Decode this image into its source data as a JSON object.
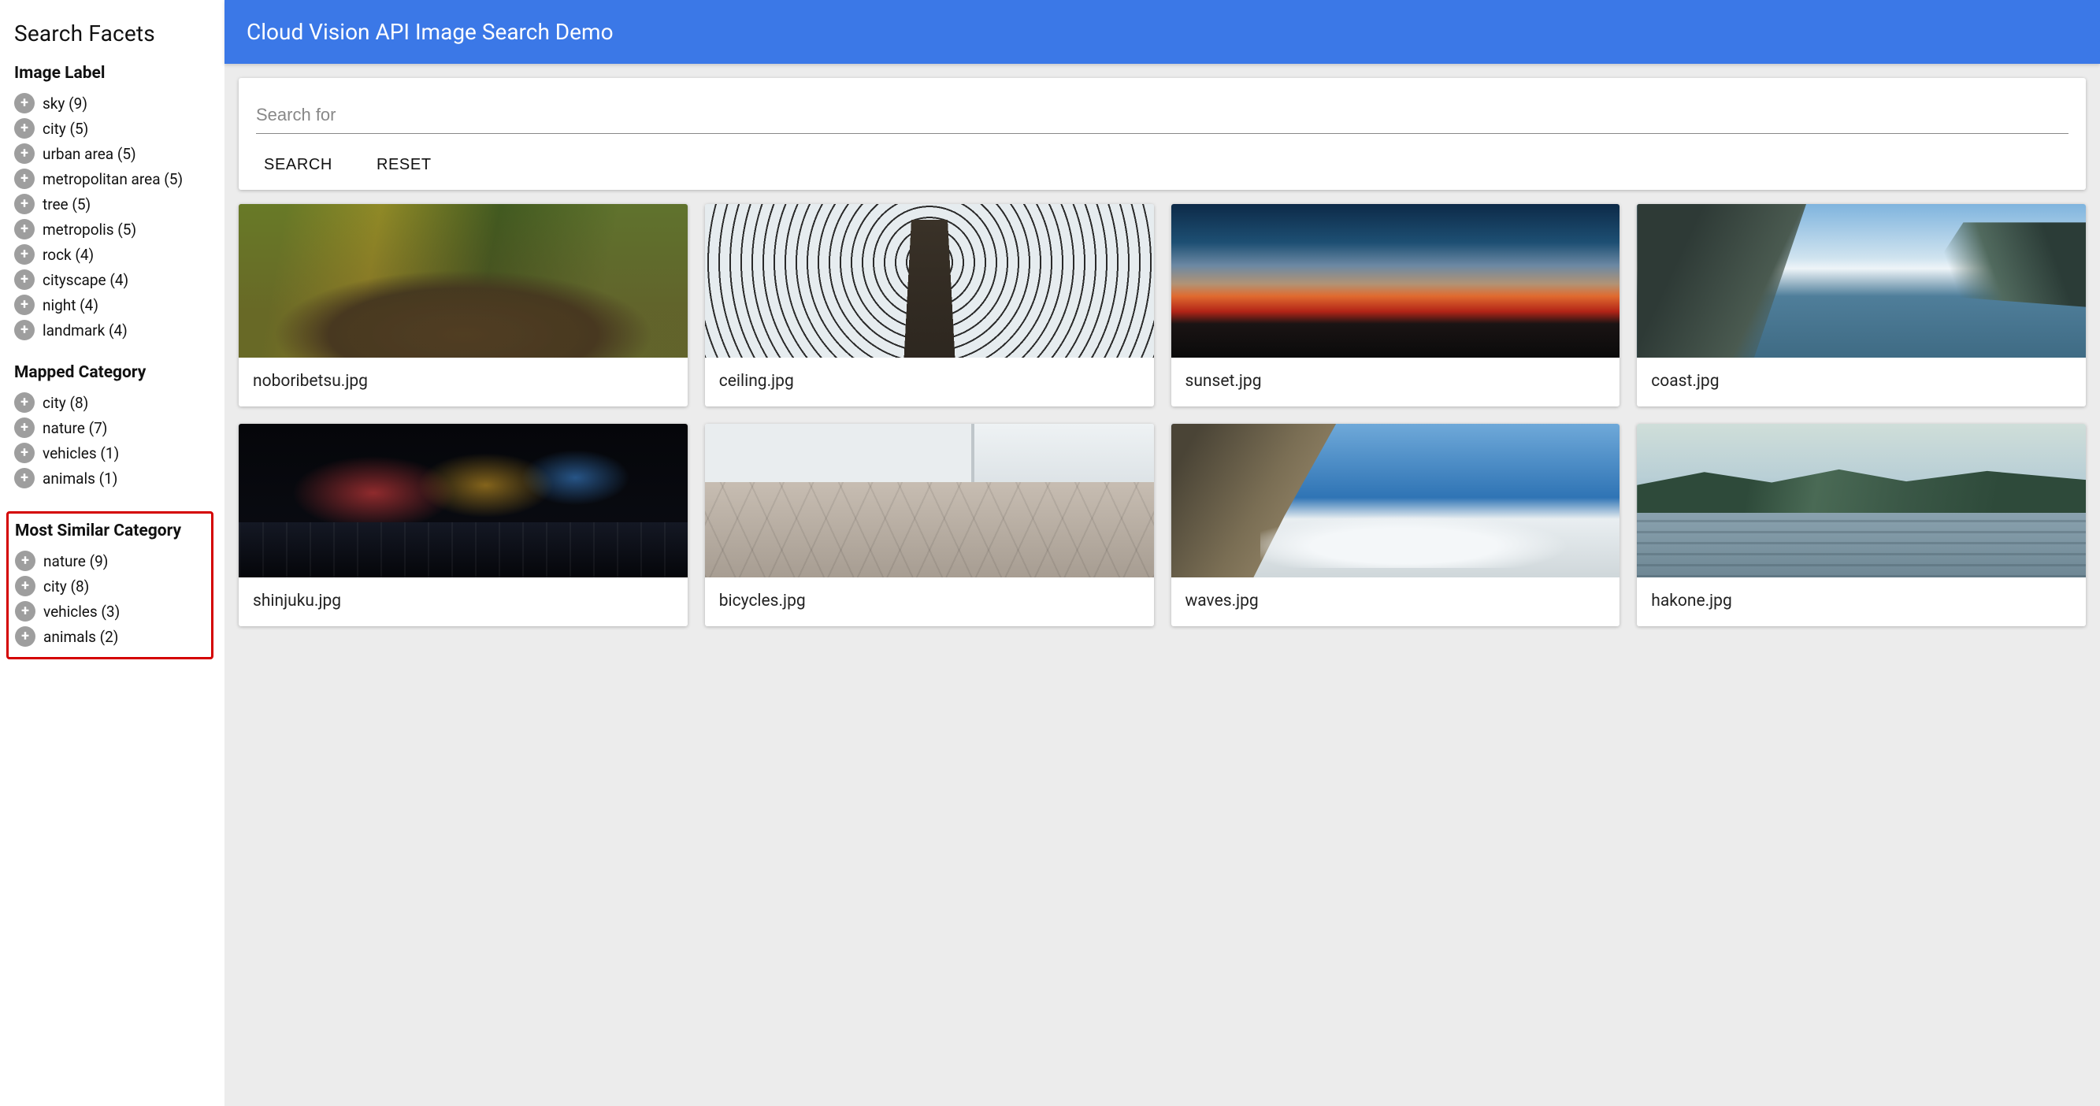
{
  "sidebar": {
    "title": "Search Facets",
    "groups": [
      {
        "title": "Image Label",
        "highlighted": false,
        "items": [
          {
            "label": "sky (9)"
          },
          {
            "label": "city (5)"
          },
          {
            "label": "urban area (5)"
          },
          {
            "label": "metropolitan area (5)"
          },
          {
            "label": "tree (5)"
          },
          {
            "label": "metropolis (5)"
          },
          {
            "label": "rock (4)"
          },
          {
            "label": "cityscape (4)"
          },
          {
            "label": "night (4)"
          },
          {
            "label": "landmark (4)"
          }
        ]
      },
      {
        "title": "Mapped Category",
        "highlighted": false,
        "items": [
          {
            "label": "city (8)"
          },
          {
            "label": "nature (7)"
          },
          {
            "label": "vehicles (1)"
          },
          {
            "label": "animals (1)"
          }
        ]
      },
      {
        "title": "Most Similar Category",
        "highlighted": true,
        "items": [
          {
            "label": "nature (9)"
          },
          {
            "label": "city (8)"
          },
          {
            "label": "vehicles (3)"
          },
          {
            "label": "animals (2)"
          }
        ]
      }
    ]
  },
  "header": {
    "title": "Cloud Vision API Image Search Demo"
  },
  "search": {
    "placeholder": "Search for",
    "value": "",
    "search_button": "SEARCH",
    "reset_button": "RESET"
  },
  "results": [
    {
      "filename": "noboribetsu.jpg",
      "thumb_class": "t-forest"
    },
    {
      "filename": "ceiling.jpg",
      "thumb_class": "t-ceiling"
    },
    {
      "filename": "sunset.jpg",
      "thumb_class": "t-sunset"
    },
    {
      "filename": "coast.jpg",
      "thumb_class": "t-coast"
    },
    {
      "filename": "shinjuku.jpg",
      "thumb_class": "t-night"
    },
    {
      "filename": "bicycles.jpg",
      "thumb_class": "t-bikes"
    },
    {
      "filename": "waves.jpg",
      "thumb_class": "t-waves"
    },
    {
      "filename": "hakone.jpg",
      "thumb_class": "t-lake"
    }
  ]
}
